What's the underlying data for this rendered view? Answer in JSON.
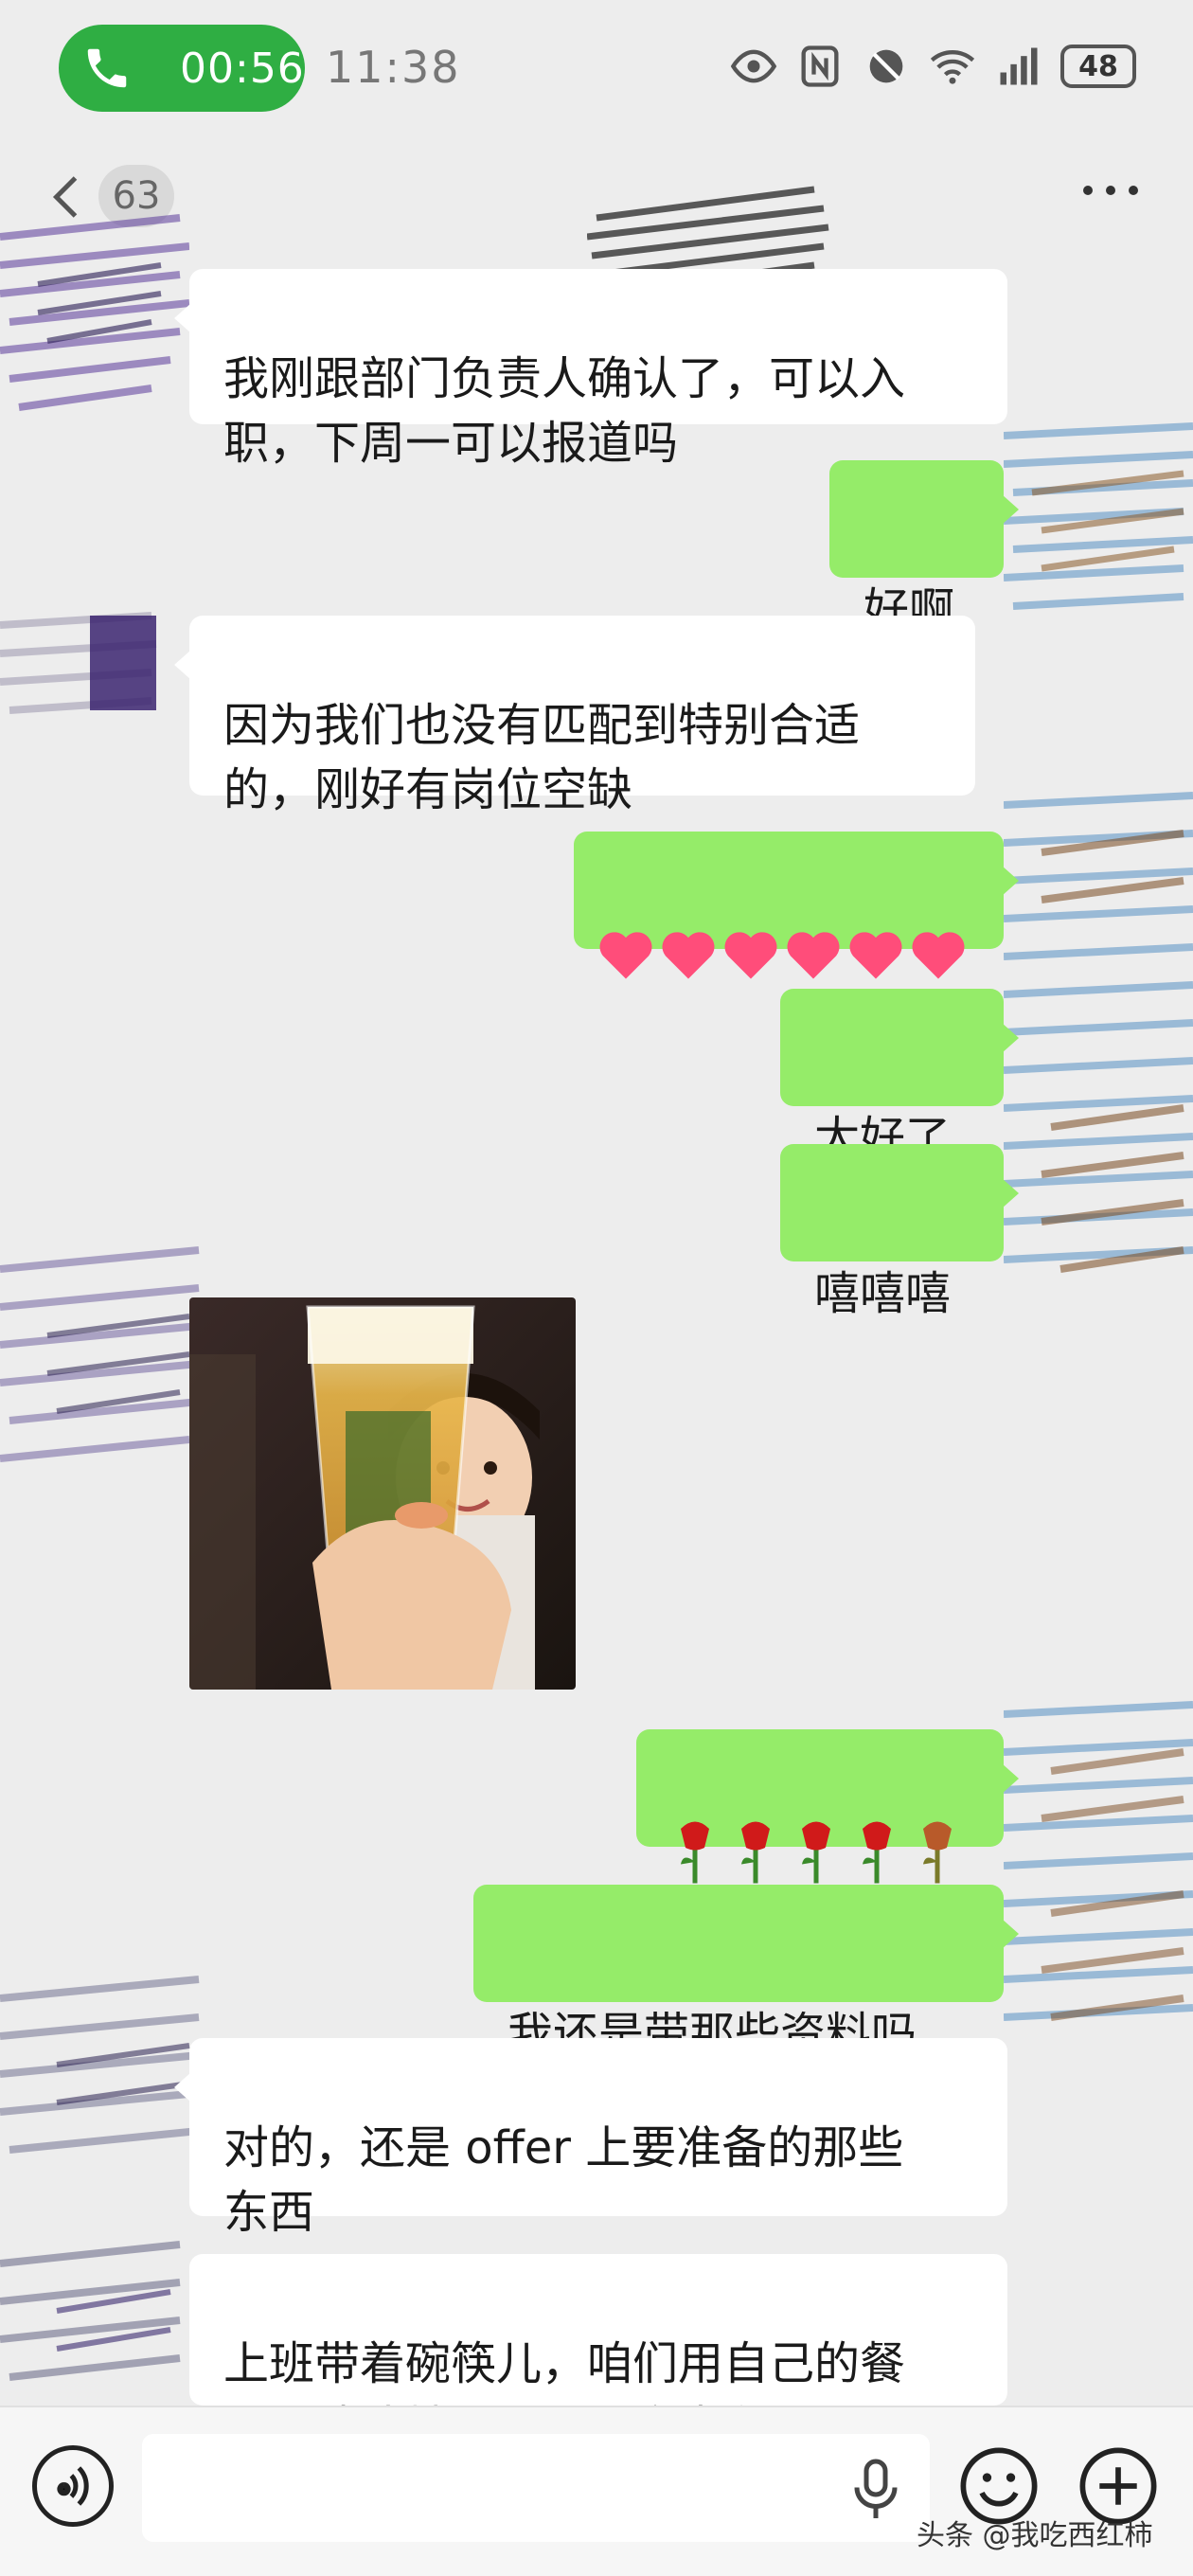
{
  "status_bar": {
    "call_timer": "00:56",
    "clock": "11:38",
    "battery": "48",
    "icons": [
      "eye-icon",
      "nfc-icon",
      "mute-icon",
      "wifi-6-icon",
      "signal-icon",
      "battery-icon"
    ]
  },
  "nav": {
    "unread_count": "63",
    "back_icon": "chevron-left-icon",
    "more_icon": "more-dots-icon"
  },
  "messages": [
    {
      "side": "left",
      "text": "我刚跟部门负责人确认了，可以入\n职，下周一可以报道吗"
    },
    {
      "side": "right",
      "text": "好啊"
    },
    {
      "side": "left",
      "text": "因为我们也没有匹配到特别合适\n的，刚好有岗位空缺"
    },
    {
      "side": "right",
      "emoji": "❤❤❤❤❤❤"
    },
    {
      "side": "right",
      "text": "太好了"
    },
    {
      "side": "right",
      "text": "嘻嘻嘻"
    },
    {
      "side": "left",
      "image": "photo-child-holding-beer-glass"
    },
    {
      "side": "right",
      "emoji": "🌹🌹🌹🌹🥀"
    },
    {
      "side": "right",
      "text": "我还是带那些资料吗"
    },
    {
      "side": "left",
      "text": "对的，还是 offer 上要准备的那些\n东西"
    },
    {
      "side": "left",
      "text": "上班带着碗筷儿，咱们用自己的餐\n具，洗洁精不用带，食堂有"
    }
  ],
  "input_bar": {
    "voice_icon": "voice-icon",
    "mic_icon": "mic-icon",
    "emoji_icon": "smiley-icon",
    "plus_icon": "plus-icon"
  },
  "watermark": "头条 @我吃西红柿",
  "colors": {
    "background": "#ededed",
    "right_bubble": "#95ec69",
    "left_bubble": "#ffffff",
    "call_pill": "#2fae43"
  }
}
